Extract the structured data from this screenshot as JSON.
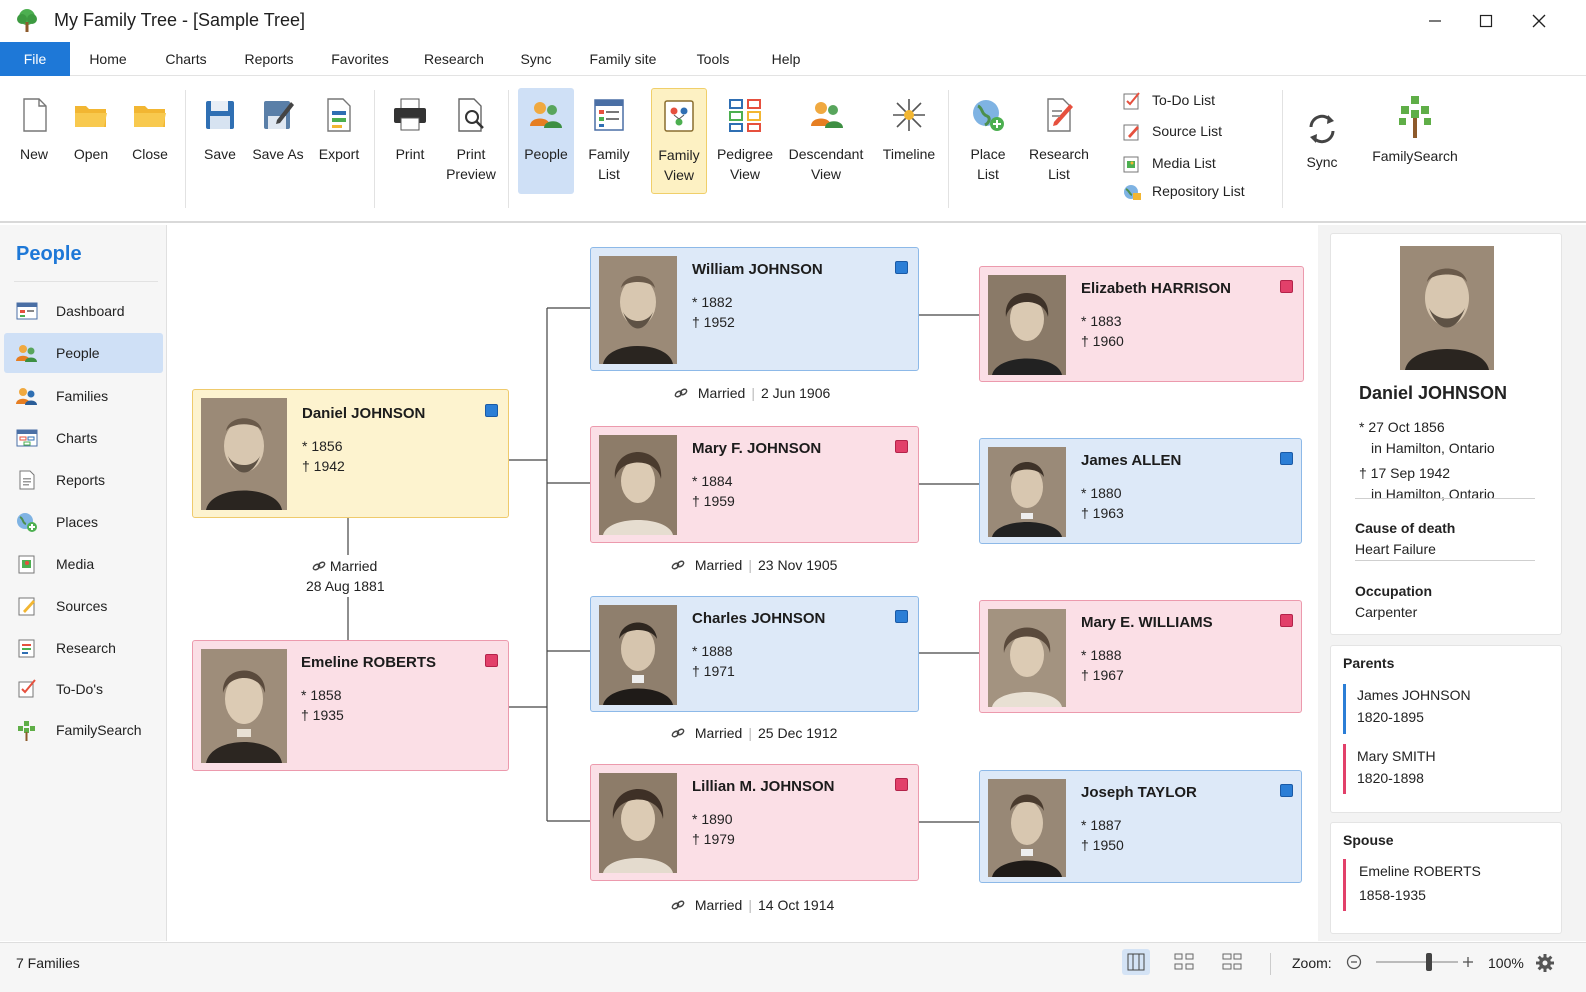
{
  "window": {
    "title": "My Family Tree - [Sample Tree]"
  },
  "menu": [
    "File",
    "Home",
    "Charts",
    "Reports",
    "Favorites",
    "Research",
    "Sync",
    "Family site",
    "Tools",
    "Help"
  ],
  "ribbon": {
    "new": "New",
    "open": "Open",
    "close": "Close",
    "save": "Save",
    "save_as": "Save As",
    "export": "Export",
    "print": "Print",
    "print_preview_1": "Print",
    "print_preview_2": "Preview",
    "people": "People",
    "family_list_1": "Family",
    "family_list_2": "List",
    "family_view_1": "Family",
    "family_view_2": "View",
    "pedigree_1": "Pedigree",
    "pedigree_2": "View",
    "descendant_1": "Descendant",
    "descendant_2": "View",
    "timeline": "Timeline",
    "place_1": "Place",
    "place_2": "List",
    "research_1": "Research",
    "research_2": "List",
    "lists": [
      "To-Do List",
      "Source List",
      "Media List",
      "Repository List"
    ],
    "sync": "Sync",
    "familysearch": "FamilySearch"
  },
  "sidebar": {
    "title": "People",
    "items": [
      "Dashboard",
      "People",
      "Families",
      "Charts",
      "Reports",
      "Places",
      "Media",
      "Sources",
      "Research",
      "To-Do's",
      "FamilySearch"
    ]
  },
  "tree": {
    "root": {
      "name": "Daniel JOHNSON",
      "birth": "* 1856",
      "death": "† 1942"
    },
    "spouse": {
      "name": "Emeline ROBERTS",
      "birth": "* 1858",
      "death": "† 1935"
    },
    "root_marriage": {
      "label": "Married",
      "date": "28 Aug 1881"
    },
    "children": [
      {
        "name": "William JOHNSON",
        "birth": "* 1882",
        "death": "† 1952",
        "married_label": "Married",
        "married_date": "2 Jun 1906",
        "spouse": {
          "name": "Elizabeth HARRISON",
          "birth": "* 1883",
          "death": "† 1960"
        }
      },
      {
        "name": "Mary F. JOHNSON",
        "birth": "* 1884",
        "death": "† 1959",
        "married_label": "Married",
        "married_date": "23 Nov 1905",
        "spouse": {
          "name": "James ALLEN",
          "birth": "* 1880",
          "death": "† 1963"
        }
      },
      {
        "name": "Charles JOHNSON",
        "birth": "* 1888",
        "death": "† 1971",
        "married_label": "Married",
        "married_date": "25 Dec 1912",
        "spouse": {
          "name": "Mary E. WILLIAMS",
          "birth": "* 1888",
          "death": "† 1967"
        }
      },
      {
        "name": "Lillian M. JOHNSON",
        "birth": "* 1890",
        "death": "† 1979",
        "married_label": "Married",
        "married_date": "14 Oct 1914",
        "spouse": {
          "name": "Joseph TAYLOR",
          "birth": "* 1887",
          "death": "† 1950"
        }
      }
    ]
  },
  "details": {
    "name": "Daniel JOHNSON",
    "birth_date": "* 27 Oct 1856",
    "birth_place": "in Hamilton, Ontario",
    "death_date": "† 17 Sep 1942",
    "death_place": "in Hamilton, Ontario",
    "cause_label": "Cause of death",
    "cause_value": "Heart Failure",
    "occupation_label": "Occupation",
    "occupation_value": "Carpenter",
    "parents_label": "Parents",
    "parents": [
      {
        "name": "James JOHNSON",
        "years": "1820-1895"
      },
      {
        "name": "Mary SMITH",
        "years": "1820-1898"
      }
    ],
    "spouse_label": "Spouse",
    "spouse": {
      "name": "Emeline ROBERTS",
      "years": "1858-1935"
    }
  },
  "status": {
    "count": "7 Families",
    "zoom_label": "Zoom:",
    "zoom_value": "100%",
    "zoom_level": 100
  },
  "colors": {
    "accent": "#1e78d7",
    "male_card": "#dde9f8",
    "female_card": "#fbdfe6",
    "focus_card": "#fdf3cf"
  }
}
